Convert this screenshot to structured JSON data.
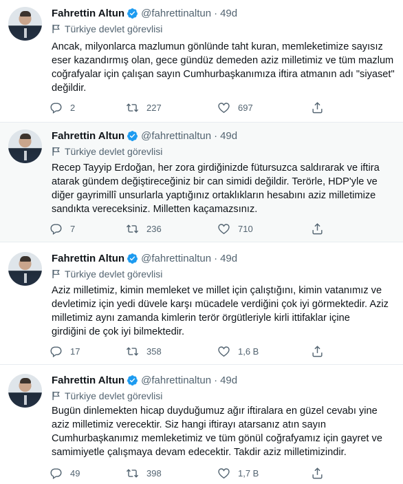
{
  "tweets": [
    {
      "name": "Fahrettin Altun",
      "handle": "@fahrettinaltun",
      "sep": "·",
      "time": "49d",
      "label": "Türkiye devlet görevlisi",
      "lines": [
        "Ancak, milyonlarca mazlumun gönlünde taht kuran, memleketimize sayısız",
        "eser kazandırmış olan, gece gündüz demeden aziz milletimiz ve tüm mazlum",
        "coğrafyalar için çalışan sayın Cumhurbaşkanımıza iftira atmanın adı \"siyaset\"",
        "değildir."
      ],
      "replies": "2",
      "retweets": "227",
      "likes": "697"
    },
    {
      "name": "Fahrettin Altun",
      "handle": "@fahrettinaltun",
      "sep": "·",
      "time": "49d",
      "label": "Türkiye devlet görevlisi",
      "lines": [
        "Recep Tayyip Erdoğan, her zora girdiğinizde fütursuzca saldırarak ve iftira",
        "atarak gündem değiştireceğiniz bir can simidi değildir. Terörle, HDP'yle ve",
        "diğer gayrimillî unsurlarla yaptığınız ortaklıkların hesabını aziz milletimize",
        "sandıkta vereceksiniz. Milletten kaçamazsınız."
      ],
      "replies": "7",
      "retweets": "236",
      "likes": "710"
    },
    {
      "name": "Fahrettin Altun",
      "handle": "@fahrettinaltun",
      "sep": "·",
      "time": "49d",
      "label": "Türkiye devlet görevlisi",
      "lines": [
        "Aziz milletimiz, kimin memleket ve millet için çalıştığını, kimin vatanımız ve",
        "devletimiz için yedi düvele karşı mücadele verdiğini çok iyi görmektedir. Aziz",
        "milletimiz aynı zamanda kimlerin terör örgütleriyle kirli ittifaklar içine",
        "girdiğini de çok iyi bilmektedir."
      ],
      "replies": "17",
      "retweets": "358",
      "likes": "1,6 B"
    },
    {
      "name": "Fahrettin Altun",
      "handle": "@fahrettinaltun",
      "sep": "·",
      "time": "49d",
      "label": "Türkiye devlet görevlisi",
      "lines": [
        "Bugün dinlemekten hicap duyduğumuz ağır iftiralara en güzel cevabı yine",
        "aziz milletimiz verecektir. Siz hangi iftirayı atarsanız atın sayın",
        "Cumhurbaşkanımız memleketimiz ve tüm gönül coğrafyamız için gayret ve",
        "samimiyetle çalışmaya devam edecektir. Takdir aziz milletimizindir."
      ],
      "replies": "49",
      "retweets": "398",
      "likes": "1,7 B"
    }
  ]
}
